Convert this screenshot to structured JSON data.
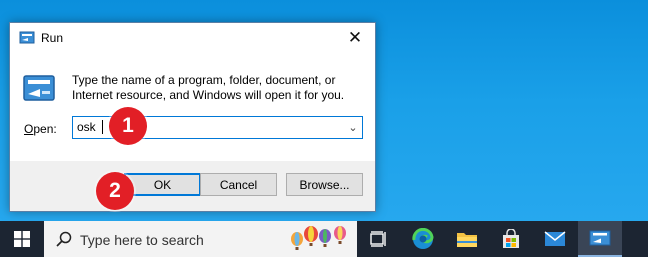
{
  "dialog": {
    "title": "Run",
    "close_label": "✕",
    "description": "Type the name of a program, folder, document, or Internet resource, and Windows will open it for you.",
    "open_label_underlined": "O",
    "open_label_rest": "pen:",
    "open_value": "osk",
    "dropdown_arrow": "⌄",
    "ok_label": "OK",
    "cancel_label": "Cancel",
    "browse_label": "Browse..."
  },
  "annotations": {
    "badge1": "1",
    "badge2": "2"
  },
  "taskbar": {
    "search_placeholder": "Type here to search",
    "icons": [
      "windows-start-icon",
      "task-view-icon",
      "edge-icon",
      "file-explorer-icon",
      "store-icon",
      "mail-icon",
      "run-icon"
    ]
  },
  "colors": {
    "desktop": "#1aa0e8",
    "taskbar": "#1c2532",
    "badge": "#e21f26",
    "focus_border": "#0078d7"
  }
}
